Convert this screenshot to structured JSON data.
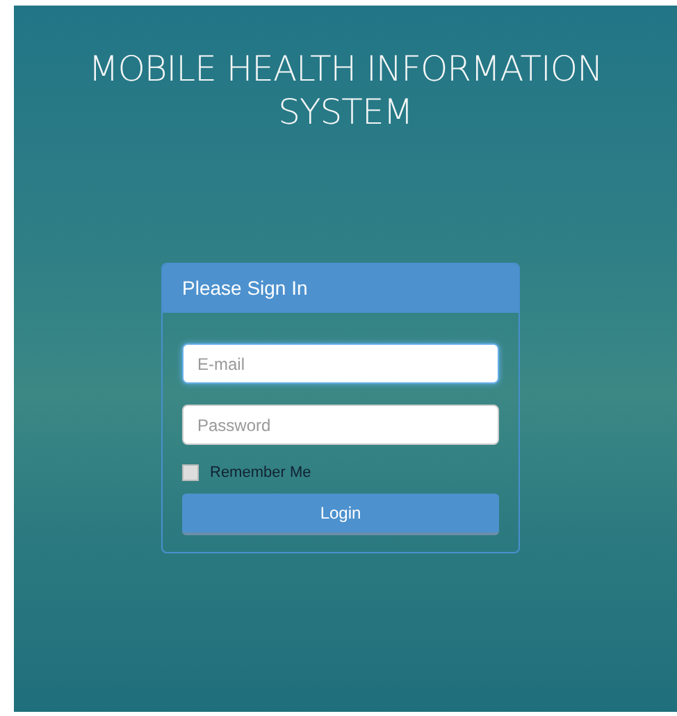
{
  "title": "MOBILE HEALTH INFORMATION SYSTEM",
  "panel": {
    "heading": "Please Sign In",
    "fields": [
      {
        "placeholder": "E-mail",
        "focused": true
      },
      {
        "placeholder": "Password",
        "focused": false
      }
    ],
    "remember": {
      "label": "Remember Me",
      "checked": false
    },
    "button": "Login"
  }
}
